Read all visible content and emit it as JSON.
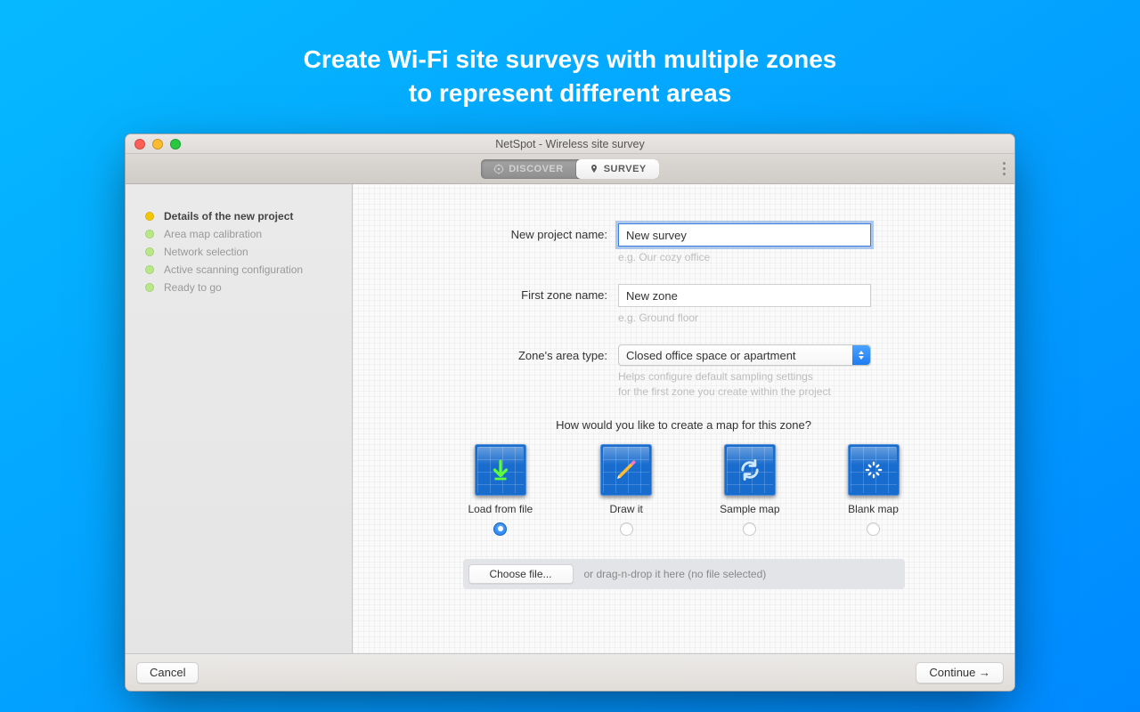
{
  "promo": {
    "line1": "Create Wi-Fi site surveys with multiple zones",
    "line2": "to represent different areas"
  },
  "window": {
    "title": "NetSpot - Wireless site survey"
  },
  "tabs": {
    "discover": "DISCOVER",
    "survey": "SURVEY"
  },
  "sidebar": {
    "items": [
      {
        "label": "Details of the new project"
      },
      {
        "label": "Area map calibration"
      },
      {
        "label": "Network selection"
      },
      {
        "label": "Active scanning configuration"
      },
      {
        "label": "Ready to go"
      }
    ]
  },
  "form": {
    "projectName": {
      "label": "New project name:",
      "value": "New survey",
      "placeholder": "e.g. Our cozy office"
    },
    "zoneName": {
      "label": "First zone name:",
      "value": "New zone",
      "placeholder": "e.g. Ground floor"
    },
    "areaType": {
      "label": "Zone's area type:",
      "value": "Closed office space or apartment",
      "hint1": "Helps configure default sampling settings",
      "hint2": "for the first zone you create within the project"
    }
  },
  "map": {
    "question": "How would you like to create a map for this zone?",
    "options": [
      {
        "label": "Load from file"
      },
      {
        "label": "Draw it"
      },
      {
        "label": "Sample map"
      },
      {
        "label": "Blank map"
      }
    ]
  },
  "dropzone": {
    "button": "Choose file...",
    "text": "or drag-n-drop it here (no file selected)"
  },
  "footer": {
    "cancel": "Cancel",
    "continue": "Continue →"
  }
}
